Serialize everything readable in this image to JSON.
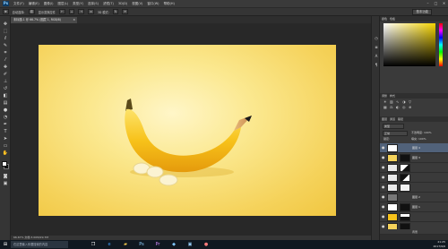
{
  "menubar": {
    "logo": "Ps",
    "items": [
      "文件(F)",
      "编辑(E)",
      "图像(I)",
      "图层(L)",
      "类型(Y)",
      "选择(S)",
      "滤镜(T)",
      "3D(D)",
      "视图(V)",
      "窗口(W)",
      "帮助(H)"
    ],
    "window_controls": [
      "–",
      "□",
      "✕"
    ]
  },
  "optbar": {
    "auto_select_label": "自动选择:",
    "auto_select_value": "组",
    "transform_label": "显示变换控件",
    "mode_3d_label": "3D 模式:",
    "workspace": "基本功能"
  },
  "document": {
    "tab_title": "未标题-1 @ 66.7% (图层 1, RGB/8)",
    "close": "×",
    "status": "66.67%   文档:3.00M/29.7M"
  },
  "panels": {
    "color_tabs": [
      "颜色",
      "色板"
    ],
    "adjust_tabs": [
      "调整",
      "样式"
    ],
    "layers_tabs": [
      "图层",
      "通道",
      "路径"
    ],
    "kind_label": "类型",
    "blend_mode": "正常",
    "opacity_label": "不透明度:",
    "opacity_value": "100%",
    "lock_label": "锁定:",
    "fill_label": "填充:",
    "fill_value": "100%"
  },
  "layers": [
    {
      "name": "图层 4",
      "selected": true
    },
    {
      "name": "图层 3",
      "selected": false
    },
    {
      "name": "",
      "selected": false
    },
    {
      "name": "",
      "selected": false
    },
    {
      "name": "",
      "selected": false
    },
    {
      "name": "图层 2",
      "selected": false
    },
    {
      "name": "图层 1",
      "selected": false
    },
    {
      "name": "",
      "selected": false
    },
    {
      "name": "",
      "selected": false
    },
    {
      "name": "背景",
      "selected": false
    }
  ],
  "taskbar": {
    "search_placeholder": "在这里输入你要搜索的内容",
    "time": "21:25",
    "date": "2017/9/6"
  },
  "colors": {
    "canvas_center": "#fff6c8",
    "canvas_edge": "#f0c640",
    "banana": "#f7c21a",
    "selected_layer": "#51627a"
  }
}
